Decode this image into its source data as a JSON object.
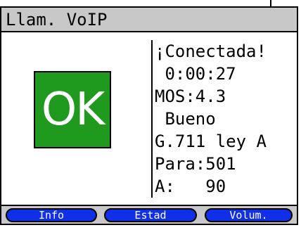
{
  "title": "Llam. VoIP",
  "status": {
    "badge": "OK",
    "badge_color": "#1f9a1f"
  },
  "call_info": [
    "¡Conectada!",
    " 0:00:27",
    "MOS:4.3",
    " Bueno",
    "G.711 ley A",
    "Para:501",
    "A:   90"
  ],
  "softkeys": [
    "Info",
    "Estad",
    "Volum."
  ],
  "colors": {
    "softkey": "#0f2fe8",
    "bars": "#c8c8c8"
  }
}
